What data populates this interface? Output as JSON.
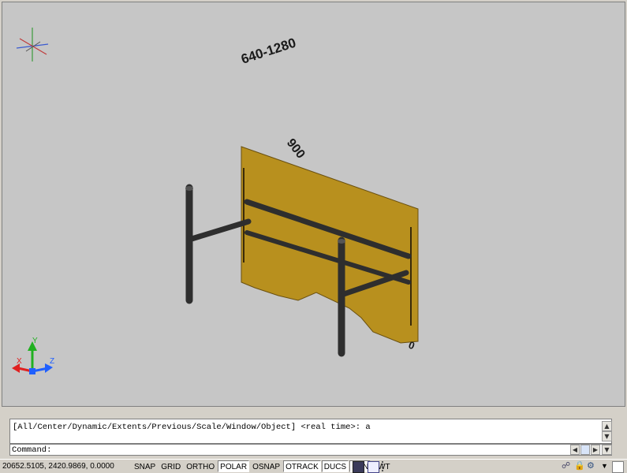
{
  "viewport": {
    "dimension_top": "640-1280",
    "dimension_side": "900",
    "dimension_small": "0",
    "ucs": {
      "x": "X",
      "y": "Y",
      "z": "Z"
    },
    "colors": {
      "background": "#c6c6c6",
      "panel": "#b8901e",
      "frame": "#2e2e2e",
      "ucs_x": "#e02020",
      "ucs_y": "#20b020",
      "ucs_z": "#2060ff"
    }
  },
  "command_line": {
    "history": "[All/Center/Dynamic/Extents/Previous/Scale/Window/Object] <real time>: a",
    "prompt": "Command:"
  },
  "status_bar": {
    "coordinates": "20652.5105, 2420.9869, 0.0000",
    "toggles": [
      {
        "label": "SNAP",
        "on": false
      },
      {
        "label": "GRID",
        "on": false
      },
      {
        "label": "ORTHO",
        "on": false
      },
      {
        "label": "POLAR",
        "on": true
      },
      {
        "label": "OSNAP",
        "on": false
      },
      {
        "label": "OTRACK",
        "on": true
      },
      {
        "label": "DUCS",
        "on": true
      },
      {
        "label": "DYN",
        "on": true
      },
      {
        "label": "LWT",
        "on": false
      }
    ],
    "icons": [
      "model-icon",
      "layout-icon",
      "comm-center-icon",
      "lock-icon",
      "toolbar-lock-icon",
      "menu-arrow-icon",
      "clean-screen-icon"
    ]
  }
}
